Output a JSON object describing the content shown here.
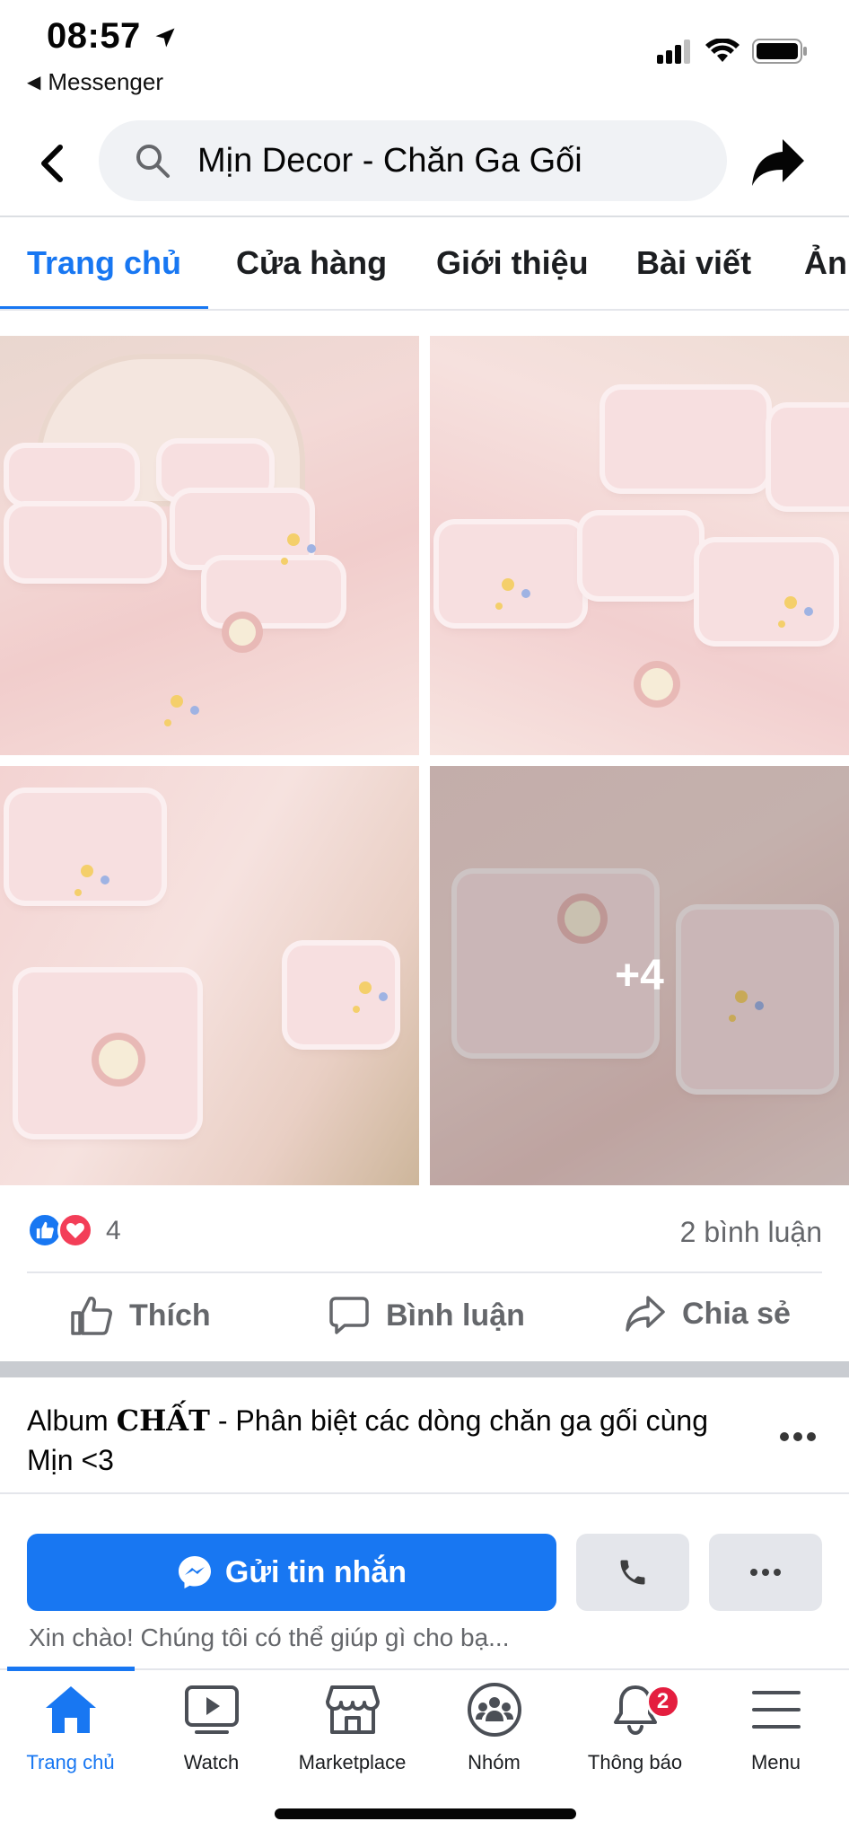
{
  "status_bar": {
    "time": "08:57",
    "back_app": "Messenger"
  },
  "header": {
    "search_text": "Mịn Decor - Chăn Ga Gối"
  },
  "tabs": [
    {
      "label": "Trang chủ",
      "active": true
    },
    {
      "label": "Cửa hàng",
      "active": false
    },
    {
      "label": "Giới thiệu",
      "active": false
    },
    {
      "label": "Bài viết",
      "active": false
    },
    {
      "label": "Ảnh",
      "active": false
    }
  ],
  "photos": {
    "more_count": "+4"
  },
  "post": {
    "reaction_count": "4",
    "comment_count": "2 bình luận",
    "actions": {
      "like": "Thích",
      "comment": "Bình luận",
      "share": "Chia sẻ"
    }
  },
  "next_post": {
    "prefix": "Album ",
    "bold": "CHẤT",
    "suffix": " - Phân biệt các dòng chăn ga gối cùng Mịn <3"
  },
  "message_bar": {
    "send_label": "Gửi tin nhắn",
    "greeting": "Xin chào! Chúng tôi có thể giúp gì cho bạ..."
  },
  "bottom_nav": [
    {
      "label": "Trang chủ",
      "icon": "home-icon",
      "active": true
    },
    {
      "label": "Watch",
      "icon": "watch-icon",
      "active": false
    },
    {
      "label": "Marketplace",
      "icon": "marketplace-icon",
      "active": false
    },
    {
      "label": "Nhóm",
      "icon": "groups-icon",
      "active": false
    },
    {
      "label": "Thông báo",
      "icon": "bell-icon",
      "active": false,
      "badge": "2"
    },
    {
      "label": "Menu",
      "icon": "menu-icon",
      "active": false
    }
  ],
  "colors": {
    "accent": "#1877f2",
    "badge": "#e41e3f",
    "secondary_text": "#65676b"
  }
}
